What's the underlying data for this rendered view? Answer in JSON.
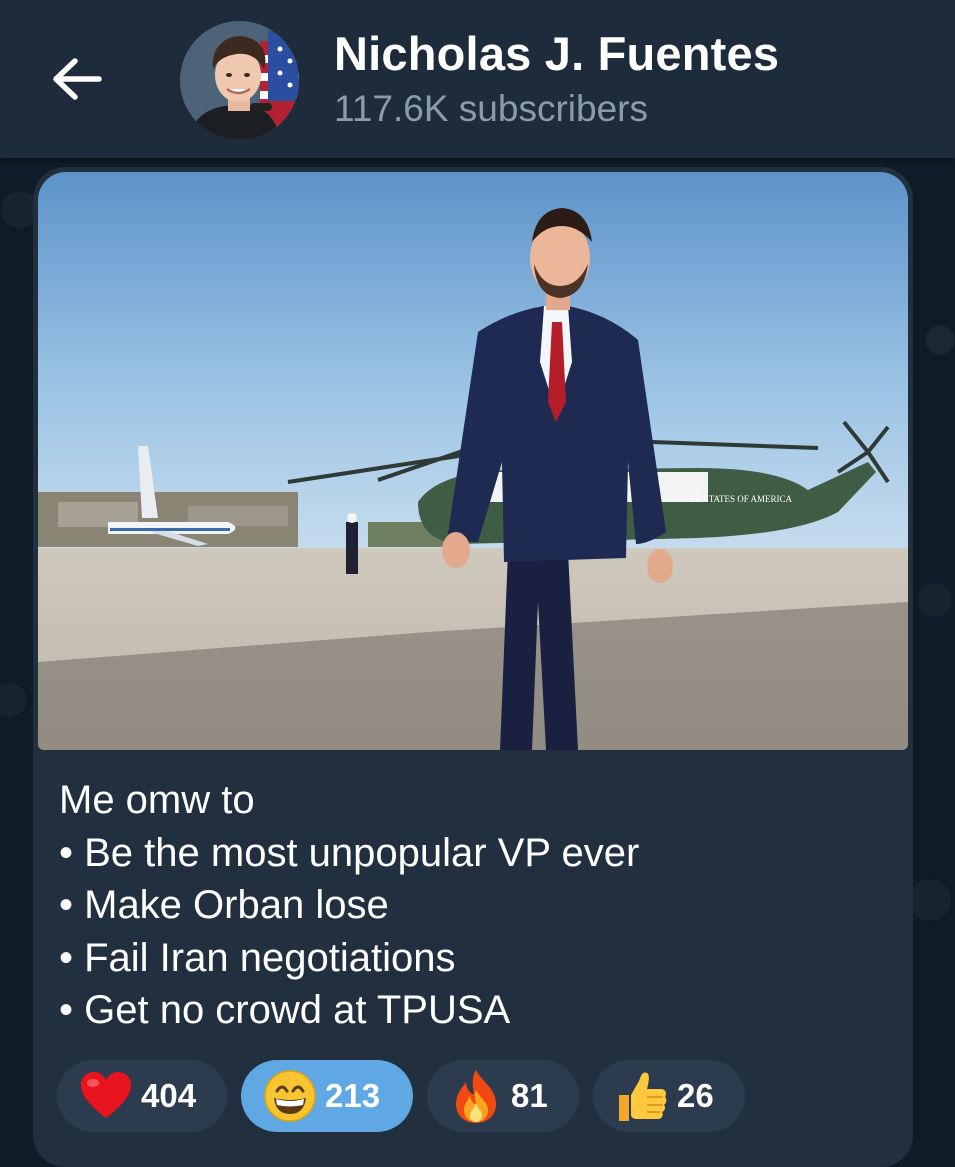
{
  "header": {
    "channel_name": "Nicholas J. Fuentes",
    "subscribers": "117.6K subscribers"
  },
  "message": {
    "caption_lines": [
      "Me omw to",
      "• Be the most unpopular VP ever",
      "• Make Orban lose",
      "• Fail Iran negotiations",
      "• Get no crowd at TPUSA"
    ],
    "photo": {
      "helicopter_marking": "UNITED STATES OF AMERICA"
    },
    "reactions": [
      {
        "icon": "heart-icon",
        "count": "404",
        "active": false
      },
      {
        "icon": "grinning-face-icon",
        "count": "213",
        "active": true
      },
      {
        "icon": "fire-icon",
        "count": "81",
        "active": false
      },
      {
        "icon": "thumbs-up-icon",
        "count": "26",
        "active": false
      }
    ]
  },
  "colors": {
    "header_bg": "#1d2b3a",
    "bubble_bg": "#212f3f",
    "reaction_bg": "#2c3c4e",
    "reaction_active_bg": "#5fa8e3",
    "subtitle_text": "#8c9bab"
  }
}
